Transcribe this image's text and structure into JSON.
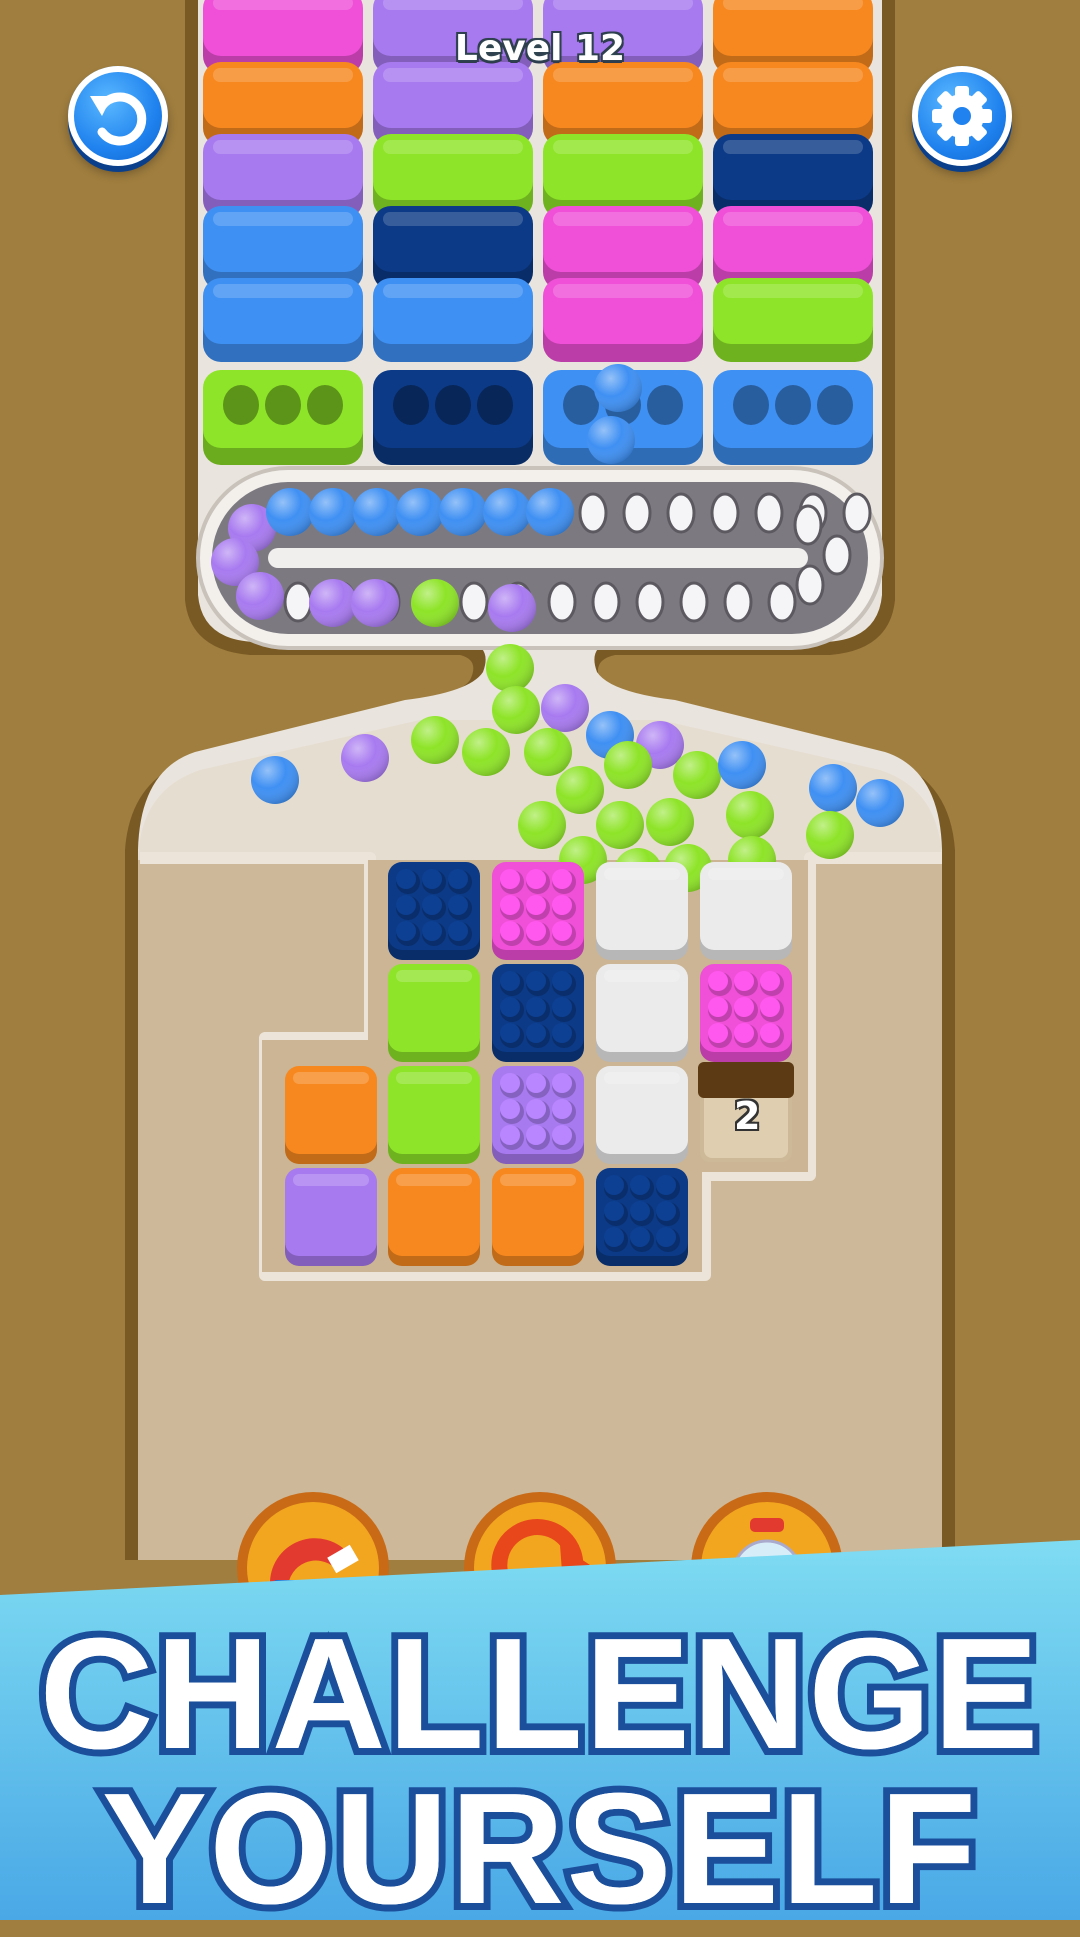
{
  "hud": {
    "level_label": "Level 12",
    "restart_icon": "restart-arrow-icon",
    "settings_icon": "gear-icon"
  },
  "colors": {
    "pink": "#f050d8",
    "purple": "#a87af0",
    "orange": "#f7881f",
    "lime": "#8ee428",
    "navy": "#0c3a86",
    "blue": "#3f90f3",
    "grey": "#ebebeb",
    "board": "#cdb899",
    "wood": "#a07e3f"
  },
  "bins": {
    "columns": [
      [
        "pink",
        "orange",
        "purple",
        "blue",
        "blue",
        "lime"
      ],
      [
        "purple",
        "purple",
        "lime",
        "navy",
        "blue",
        "navy"
      ],
      [
        "purple",
        "orange",
        "lime",
        "pink",
        "pink",
        "blue"
      ],
      [
        "orange",
        "orange",
        "navy",
        "pink",
        "lime",
        "blue"
      ]
    ]
  },
  "conveyor": {
    "balls": [
      "purple",
      "purple",
      "purple",
      "blue",
      "blue",
      "blue",
      "blue",
      "blue",
      "blue",
      "blue",
      "purple",
      "purple",
      "lime",
      "purple"
    ]
  },
  "grid": {
    "cells": [
      {
        "row": 0,
        "col": 1,
        "color": "navy",
        "filled": true
      },
      {
        "row": 0,
        "col": 2,
        "color": "pink",
        "filled": true
      },
      {
        "row": 0,
        "col": 3,
        "color": "grey",
        "filled": false
      },
      {
        "row": 0,
        "col": 4,
        "color": "grey",
        "filled": false
      },
      {
        "row": 1,
        "col": 1,
        "color": "lime",
        "filled": false
      },
      {
        "row": 1,
        "col": 2,
        "color": "navy",
        "filled": true
      },
      {
        "row": 1,
        "col": 3,
        "color": "grey",
        "filled": false
      },
      {
        "row": 1,
        "col": 4,
        "color": "pink",
        "filled": true
      },
      {
        "row": 2,
        "col": 0,
        "color": "orange",
        "filled": false
      },
      {
        "row": 2,
        "col": 1,
        "color": "lime",
        "filled": false
      },
      {
        "row": 2,
        "col": 2,
        "color": "purple",
        "filled": true
      },
      {
        "row": 2,
        "col": 3,
        "color": "grey",
        "filled": false
      },
      {
        "row": 3,
        "col": 0,
        "color": "purple",
        "filled": false
      },
      {
        "row": 3,
        "col": 1,
        "color": "orange",
        "filled": false
      },
      {
        "row": 3,
        "col": 2,
        "color": "orange",
        "filled": false
      },
      {
        "row": 3,
        "col": 3,
        "color": "navy",
        "filled": true
      }
    ],
    "locked_box": {
      "row": 2,
      "col": 4,
      "count": "2"
    }
  },
  "boosters": [
    {
      "name": "magnet-booster",
      "icon": "magnet-icon"
    },
    {
      "name": "refresh-booster",
      "icon": "refresh-icon"
    },
    {
      "name": "gumball-booster",
      "icon": "gumball-machine-icon"
    }
  ],
  "banner": {
    "line1": "CHALLENGE",
    "line2": "YOURSELF"
  }
}
